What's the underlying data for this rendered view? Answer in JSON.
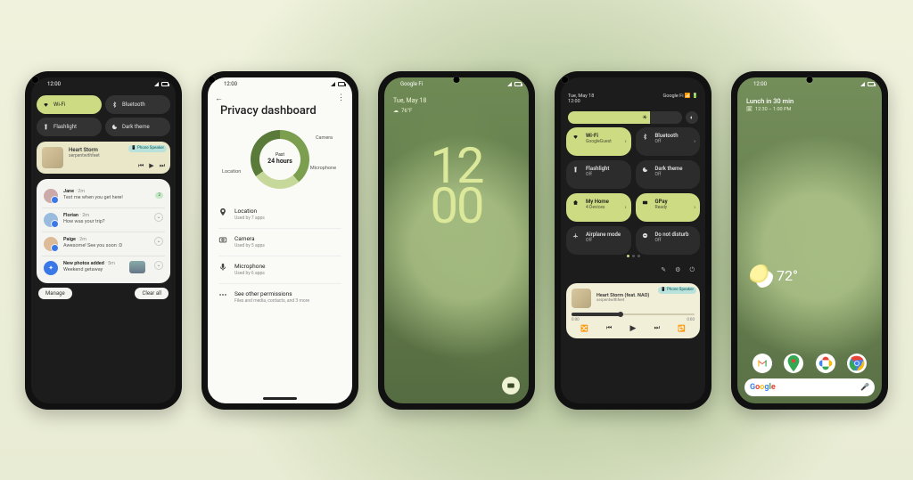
{
  "colors": {
    "accent": "#cddc82",
    "dark": "#1c1c1c",
    "light_bg": "#fafaf7"
  },
  "phone1": {
    "status": {
      "time": "12:00"
    },
    "qs": {
      "wifi": {
        "label": "Wi-Fi",
        "active": true
      },
      "bluetooth": {
        "label": "Bluetooth",
        "active": false
      },
      "flashlight": {
        "label": "Flashlight",
        "active": false
      },
      "darktheme": {
        "label": "Dark theme",
        "active": false
      }
    },
    "media": {
      "title": "Heart Storm",
      "artist": "serpentwithfeet",
      "output": "Phone Speaker"
    },
    "notifications": [
      {
        "name": "Jane",
        "age": "2m",
        "msg": "Text me when you get here!",
        "reply_count": "2"
      },
      {
        "name": "Florian",
        "age": "2m",
        "msg": "How was your trip?"
      },
      {
        "name": "Paige",
        "age": "2m",
        "msg": "Awesome! See you soon :D"
      }
    ],
    "photo_notif": {
      "title": "New photos added",
      "age": "5m",
      "sub": "Weekend getaway"
    },
    "actions": {
      "manage": "Manage",
      "clear": "Clear all"
    }
  },
  "phone2": {
    "status": {
      "time": "12:00"
    },
    "title": "Privacy dashboard",
    "donut": {
      "center_top": "Past",
      "center_main": "24 hours",
      "labels": {
        "camera": "Camera",
        "microphone": "Microphone",
        "location": "Location"
      }
    },
    "rows": {
      "location": {
        "title": "Location",
        "sub": "Used by 7 apps"
      },
      "camera": {
        "title": "Camera",
        "sub": "Used by 5 apps"
      },
      "microphone": {
        "title": "Microphone",
        "sub": "Used by 6 apps"
      },
      "other": {
        "title": "See other permissions",
        "sub": "Files and media, contacts, and 3 more"
      }
    }
  },
  "phone3": {
    "carrier": "Google Fi",
    "date": "Tue, May 18",
    "weather": "76°F",
    "clock_top": "12",
    "clock_bottom": "00"
  },
  "phone4": {
    "status": {
      "date": "Tue, May 18",
      "time": "12:00",
      "carrier": "Google Fi"
    },
    "brightness_pct": 72,
    "tiles": {
      "wifi": {
        "title": "Wi-Fi",
        "sub": "GoogleGuest",
        "active": true
      },
      "bluetooth": {
        "title": "Bluetooth",
        "sub": "Off",
        "active": false
      },
      "flashlight": {
        "title": "Flashlight",
        "sub": "Off",
        "active": false
      },
      "darktheme": {
        "title": "Dark theme",
        "sub": "Off",
        "active": false
      },
      "home": {
        "title": "My Home",
        "sub": "4 Devices",
        "active": true
      },
      "gpay": {
        "title": "GPay",
        "sub": "Ready",
        "active": true
      },
      "airplane": {
        "title": "Airplane mode",
        "sub": "Off",
        "active": false
      },
      "dnd": {
        "title": "Do not disturb",
        "sub": "Off",
        "active": false
      }
    },
    "media": {
      "title": "Heart Storm (feat. NAO)",
      "artist": "serpentwithfeet",
      "output": "Phone Speaker",
      "elapsed": "0:00",
      "total": "0:00"
    }
  },
  "phone5": {
    "status_time": "12:00",
    "event_title": "Lunch in 30 min",
    "event_time": "12:30 – 1:00 PM",
    "temp": "72°"
  }
}
